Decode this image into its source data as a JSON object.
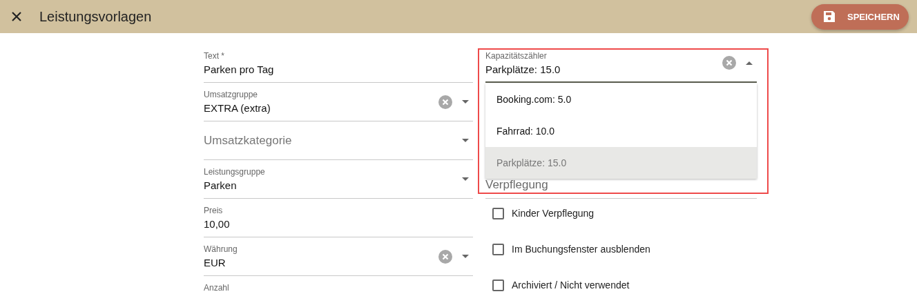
{
  "header": {
    "title": "Leistungsvorlagen",
    "save_button": "SPEICHERN"
  },
  "left_fields": [
    {
      "kind": "text",
      "label": "Text *",
      "value": "Parken pro Tag",
      "clearable": false,
      "dropdown": false
    },
    {
      "kind": "select",
      "label": "Umsatzgruppe",
      "value": "EXTRA (extra)",
      "clearable": true,
      "dropdown": true
    },
    {
      "kind": "empty",
      "placeholder": "Umsatzkategorie",
      "clearable": false,
      "dropdown": true
    },
    {
      "kind": "select",
      "label": "Leistungsgruppe",
      "value": "Parken",
      "clearable": false,
      "dropdown": true
    },
    {
      "kind": "text",
      "label": "Preis",
      "value": "10,00",
      "clearable": false,
      "dropdown": false
    },
    {
      "kind": "select",
      "label": "Währung",
      "value": "EUR",
      "clearable": true,
      "dropdown": true
    },
    {
      "kind": "text",
      "label": "Anzahl",
      "clearable": false,
      "dropdown": false
    }
  ],
  "capacity_field": {
    "label": "Kapazitätszähler",
    "value": "Parkplätze: 15.0",
    "clearable": true,
    "expanded": true,
    "highlighted": true,
    "options": [
      {
        "label": "Booking.com: 5.0",
        "selected": false
      },
      {
        "label": "Fahrrad: 10.0",
        "selected": false
      },
      {
        "label": "Parkplätze: 15.0",
        "selected": true
      }
    ]
  },
  "meal_field": {
    "placeholder": "Verpflegung"
  },
  "checkboxes": [
    {
      "label": "Kinder Verpflegung",
      "checked": false
    },
    {
      "label": "Im Buchungsfenster ausblenden",
      "checked": false
    },
    {
      "label": "Archiviert / Nicht verwendet",
      "checked": false
    }
  ]
}
